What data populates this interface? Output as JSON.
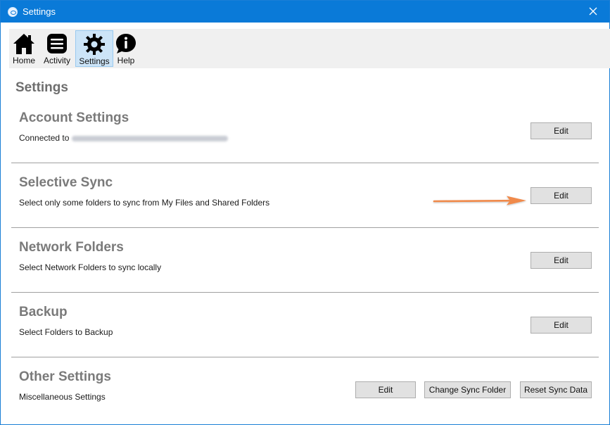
{
  "window": {
    "title": "Settings",
    "accent": "#0a7ad8"
  },
  "toolbar": {
    "items": [
      {
        "label": "Home",
        "icon": "home-icon"
      },
      {
        "label": "Activity",
        "icon": "activity-icon"
      },
      {
        "label": "Settings",
        "icon": "gear-icon",
        "active": true
      },
      {
        "label": "Help",
        "icon": "help-icon"
      }
    ]
  },
  "page": {
    "title": "Settings"
  },
  "sections": {
    "account": {
      "title": "Account Settings",
      "desc_prefix": "Connected to",
      "edit": "Edit"
    },
    "selective": {
      "title": "Selective Sync",
      "desc": "Select only some folders to sync from My Files and Shared Folders",
      "edit": "Edit"
    },
    "network": {
      "title": "Network Folders",
      "desc": "Select Network Folders to sync locally",
      "edit": "Edit"
    },
    "backup": {
      "title": "Backup",
      "desc": "Select Folders to Backup",
      "edit": "Edit"
    },
    "other": {
      "title": "Other Settings",
      "desc": "Miscellaneous Settings",
      "edit": "Edit",
      "change_folder": "Change Sync Folder",
      "reset": "Reset Sync Data"
    }
  },
  "annotation": {
    "arrow_color": "#f08a4b"
  }
}
